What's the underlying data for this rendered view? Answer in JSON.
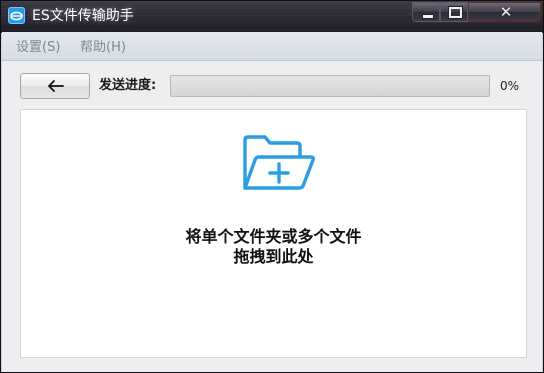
{
  "window": {
    "title": "ES文件传输助手",
    "icon": "es-app-icon",
    "controls": {
      "minimize": "minimize-icon",
      "maximize": "maximize-icon",
      "close": "close-icon",
      "close_glyph": "✕"
    }
  },
  "menubar": {
    "items": [
      {
        "label": "设置(S)"
      },
      {
        "label": "帮助(H)"
      }
    ]
  },
  "toolbar": {
    "back_icon": "arrow-left-icon",
    "progress_label": "发送进度:",
    "progress_percent": "0%",
    "progress_value": 0
  },
  "drop_zone": {
    "icon": "folder-add-icon",
    "line1": "将单个文件夹或多个文件",
    "line2": "拖拽到此处"
  },
  "colors": {
    "accent": "#2a9fe0",
    "titlebar": "#26262f",
    "menubar": "#dde2e8"
  }
}
